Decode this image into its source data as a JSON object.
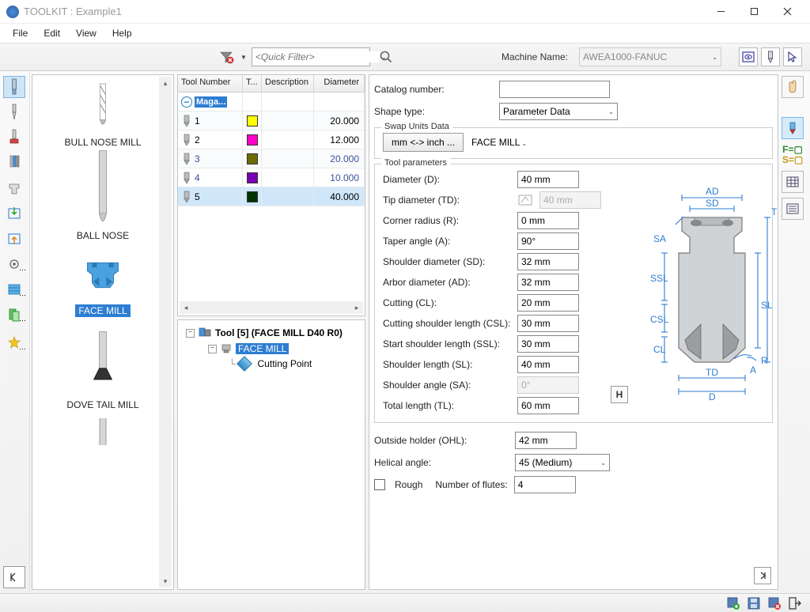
{
  "window": {
    "title": "TOOLKIT : Example1"
  },
  "menu": {
    "file": "File",
    "edit": "Edit",
    "view": "View",
    "help": "Help"
  },
  "toolbar": {
    "quickfilter_placeholder": "<Quick Filter>",
    "machine_label": "Machine Name:",
    "machine_value": "AWEA1000-FANUC"
  },
  "toolList": {
    "items": [
      {
        "label": "BULL NOSE MILL",
        "kind": "bullnose"
      },
      {
        "label": "BALL NOSE",
        "kind": "ballnose"
      },
      {
        "label": "FACE MILL",
        "kind": "facemill",
        "selected": true
      },
      {
        "label": "DOVE TAIL MILL",
        "kind": "dovetail"
      }
    ]
  },
  "table": {
    "headers": {
      "num": "Tool Number",
      "t": "T...",
      "desc": "Description",
      "dia": "Diameter"
    },
    "mag_label": "Maga...",
    "rows": [
      {
        "n": "1",
        "color": "#ffff00",
        "dia": "20.000"
      },
      {
        "n": "2",
        "color": "#ff00c8",
        "dia": "12.000"
      },
      {
        "n": "3",
        "color": "#6b6b00",
        "dia": "20.000",
        "dark": true
      },
      {
        "n": "4",
        "color": "#7a00b5",
        "dia": "10.000",
        "dark": true
      },
      {
        "n": "5",
        "color": "#003300",
        "dia": "40.000",
        "selected": true
      }
    ]
  },
  "tree": {
    "root": "Tool [5] (FACE MILL D40 R0)",
    "child": "FACE MILL",
    "leaf": "Cutting Point"
  },
  "detail": {
    "catalog_label": "Catalog number:",
    "catalog_value": "",
    "shape_label": "Shape type:",
    "shape_value": "Parameter Data",
    "swap_legend": "Swap Units Data",
    "swap_button": "mm <-> inch ...",
    "type_value": "FACE MILL",
    "params_legend": "Tool parameters",
    "params": {
      "d": {
        "label": "Diameter (D):",
        "value": "40 mm"
      },
      "td": {
        "label": "Tip diameter (TD):",
        "value": "40 mm",
        "disabled": true
      },
      "r": {
        "label": "Corner radius (R):",
        "value": "0 mm"
      },
      "a": {
        "label": "Taper angle (A):",
        "value": "90°"
      },
      "sd": {
        "label": "Shoulder diameter (SD):",
        "value": "32 mm"
      },
      "ad": {
        "label": "Arbor diameter (AD):",
        "value": "32 mm"
      },
      "cl": {
        "label": "Cutting (CL):",
        "value": "20 mm"
      },
      "csl": {
        "label": "Cutting shoulder length (CSL):",
        "value": "30 mm"
      },
      "ssl": {
        "label": "Start shoulder length (SSL):",
        "value": "30 mm"
      },
      "sl": {
        "label": "Shoulder length (SL):",
        "value": "40 mm"
      },
      "sa": {
        "label": "Shoulder angle (SA):",
        "value": "0°",
        "disabled": true
      },
      "tl": {
        "label": "Total length (TL):",
        "value": "60 mm"
      }
    },
    "ohl": {
      "label": "Outside holder (OHL):",
      "value": "42 mm"
    },
    "helical": {
      "label": "Helical angle:",
      "value": "45 (Medium)"
    },
    "rough_label": "Rough",
    "flutes_label": "Number of flutes:",
    "flutes_value": "4",
    "h_button": "H"
  }
}
